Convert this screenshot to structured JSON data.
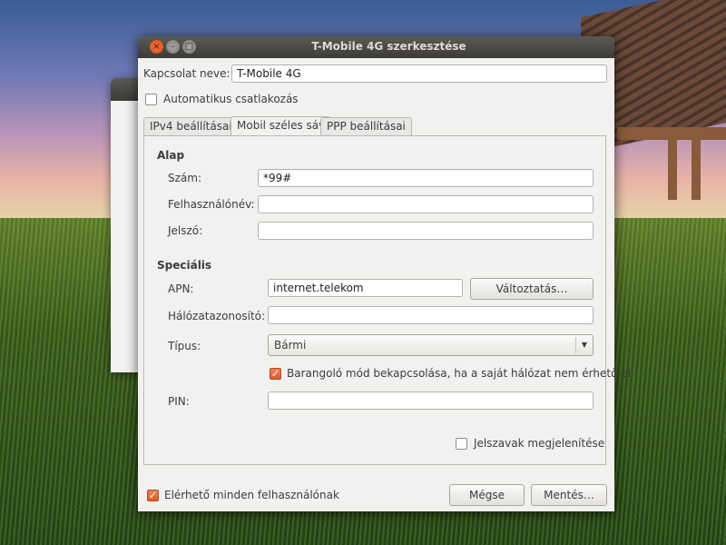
{
  "window": {
    "title": "T-Mobile 4G szerkesztése"
  },
  "connection": {
    "name_label": "Kapcsolat neve:",
    "name_value": "T-Mobile 4G",
    "auto_connect_label": "Automatikus csatlakozás",
    "auto_connect_checked": false
  },
  "tabs": [
    {
      "label": "IPv4 beállításai",
      "active": false
    },
    {
      "label": "Mobil széles sáv",
      "active": true
    },
    {
      "label": "PPP beállításai",
      "active": false
    }
  ],
  "basic": {
    "heading": "Alap",
    "number_label": "Szám:",
    "number_value": "*99#",
    "username_label": "Felhasználónév:",
    "username_value": "",
    "password_label": "Jelszó:",
    "password_value": ""
  },
  "advanced": {
    "heading": "Speciális",
    "apn_label": "APN:",
    "apn_value": "internet.telekom",
    "change_button": "Változtatás…",
    "network_id_label": "Hálózatazonosító:",
    "network_id_value": "",
    "type_label": "Típus:",
    "type_value": "Bármi",
    "roaming_label": "Barangoló mód bekapcsolása, ha a saját hálózat nem érhető el",
    "roaming_checked": true,
    "pin_label": "PIN:",
    "pin_value": ""
  },
  "show_passwords_label": "Jelszavak megjelenítése",
  "show_passwords_checked": false,
  "footer": {
    "all_users_label": "Elérhető minden felhasználónak",
    "all_users_checked": true,
    "cancel_button": "Mégse",
    "save_button": "Mentés…"
  },
  "colors": {
    "accent": "#dd4814",
    "titlebar": "#3c3b37"
  }
}
